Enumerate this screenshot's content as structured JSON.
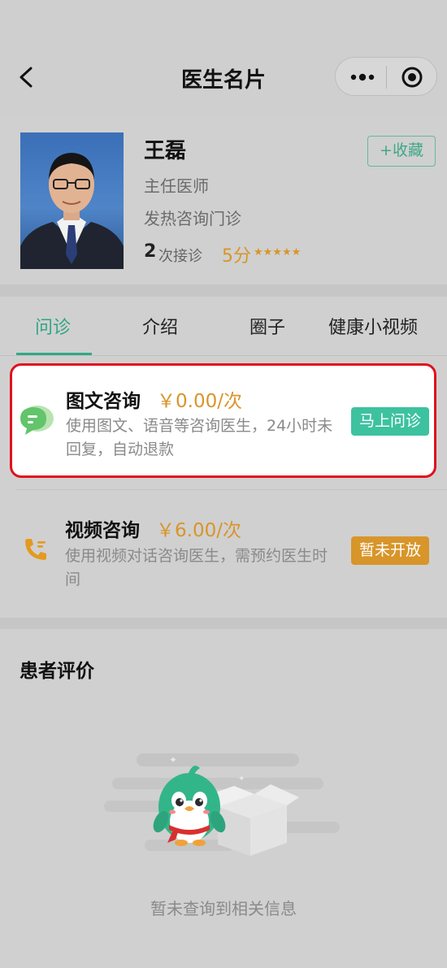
{
  "header": {
    "title": "医生名片",
    "back_icon": "chevron-left-icon",
    "more_icon": "more-dots-icon",
    "close_icon": "target-icon"
  },
  "doctor": {
    "name": "王磊",
    "title": "主任医师",
    "department": "发热咨询门诊",
    "visits_count": "2",
    "visits_label": "次接诊",
    "score": "5分",
    "stars": "★★★★★",
    "favorite_label": "+收藏"
  },
  "tabs": [
    {
      "label": "问诊",
      "active": true
    },
    {
      "label": "介绍",
      "active": false
    },
    {
      "label": "圈子",
      "active": false
    },
    {
      "label": "健康小视频",
      "active": false
    }
  ],
  "consult_items": [
    {
      "title": "图文咨询",
      "price": "￥0.00/次",
      "description": "使用图文、语音等咨询医生，24小时未回复，自动退款",
      "button_label": "马上问诊",
      "icon": "chat-bubble-icon",
      "accent": "#3dc2a0"
    },
    {
      "title": "视频咨询",
      "price": "￥6.00/次",
      "description": "使用视频对话咨询医生，需预约医生时间",
      "button_label": "暂未开放",
      "icon": "phone-icon",
      "accent": "#d8952a"
    }
  ],
  "reviews": {
    "title": "患者评价",
    "empty_text": "暂未查询到相关信息"
  },
  "colors": {
    "brand_green": "#2ea684",
    "price_orange": "#d8952a",
    "highlight_red": "#e0121c"
  }
}
